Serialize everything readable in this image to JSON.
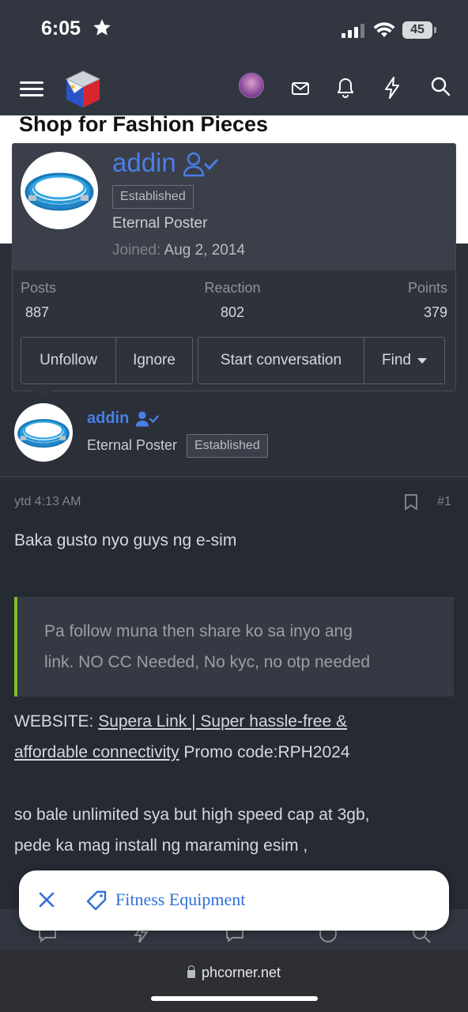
{
  "status_bar": {
    "time": "6:05",
    "battery": "45"
  },
  "page_header": {
    "shop_title": "Shop for Fashion Pieces"
  },
  "popup": {
    "username": "addin",
    "badge": "Established",
    "user_title": "Eternal Poster",
    "joined_label": "Joined:",
    "joined_date": "Aug 2, 2014",
    "stats": [
      {
        "label": "Posts",
        "value": "887"
      },
      {
        "label": "Reaction",
        "value": "802"
      },
      {
        "label": "Points",
        "value": "379"
      }
    ],
    "buttons": {
      "unfollow": "Unfollow",
      "ignore": "Ignore",
      "start_conversation": "Start conversation",
      "find": "Find"
    }
  },
  "post": {
    "username": "addin",
    "user_title": "Eternal Poster",
    "badge": "Established",
    "time": "ytd 4:13 AM",
    "number": "#1",
    "line1": "Baka gusto nyo guys ng e-sim",
    "quote_line1": "Pa follow muna then share ko sa inyo ang",
    "quote_line2": "link. NO CC Needed, No kyc, no otp needed",
    "website_label": "WEBSITE: ",
    "link_line1": "Supera Link | Super hassle-free &",
    "link_line2": "affordable connectivity",
    "promo": " Promo code:RPH2024",
    "line_a": "so bale unlimited sya but high speed cap at 3gb,",
    "line_b": "pede ka mag install ng maraming esim ,"
  },
  "floating_pill": {
    "label": "Fitness Equipment"
  },
  "browser": {
    "url": "phcorner.net"
  },
  "colors": {
    "accent_blue": "#4a7fe6",
    "quote_bar": "#7cbd2e",
    "background": "#262a33"
  }
}
